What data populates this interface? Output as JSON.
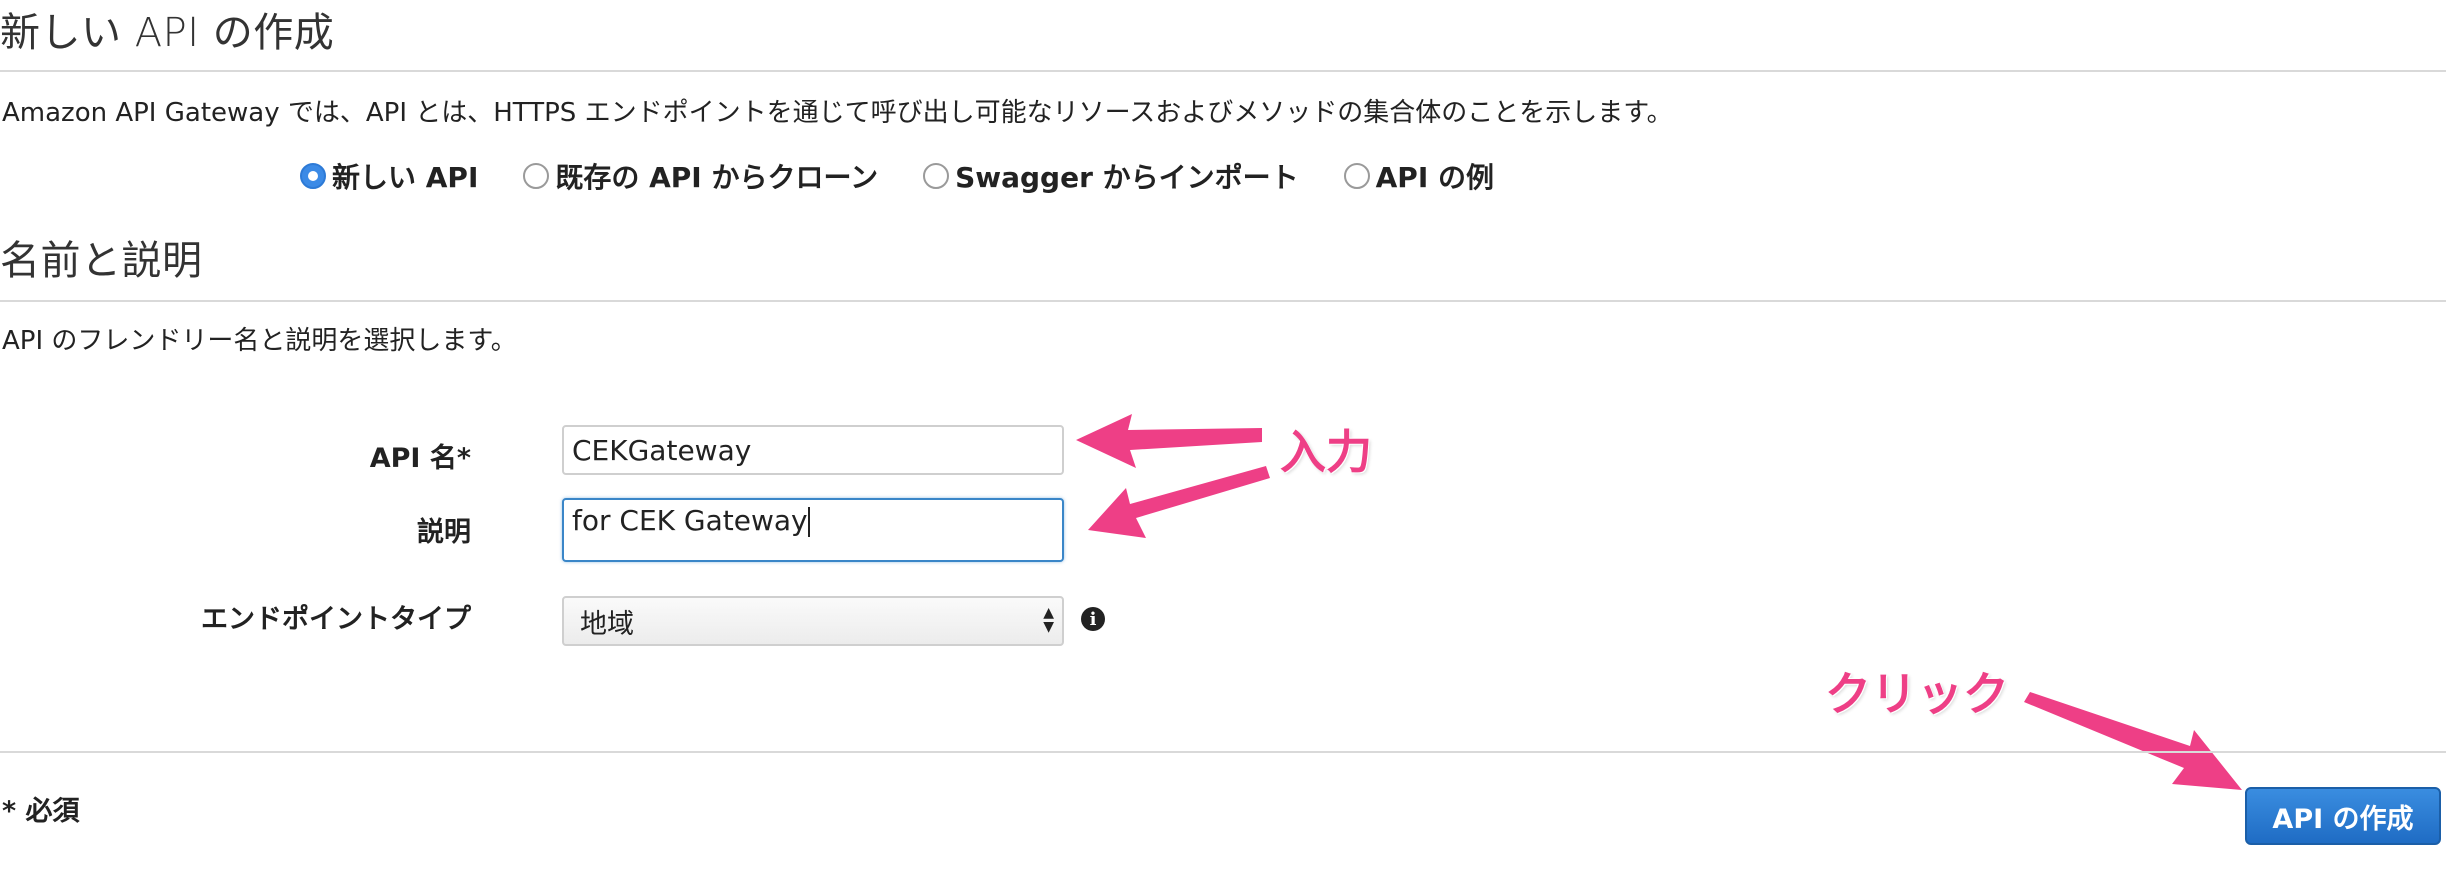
{
  "header": {
    "title": "新しい API の作成",
    "description": "Amazon API Gateway では、API とは、HTTPS エンドポイントを通じて呼び出し可能なリソースおよびメソッドの集合体のことを示します。"
  },
  "api_type": {
    "options": [
      {
        "label": "新しい API",
        "selected": true
      },
      {
        "label": "既存の API からクローン",
        "selected": false
      },
      {
        "label": "Swagger からインポート",
        "selected": false
      },
      {
        "label": "API の例",
        "selected": false
      }
    ]
  },
  "name_section": {
    "title": "名前と説明",
    "description": "API のフレンドリー名と説明を選択します。"
  },
  "form": {
    "api_name_label": "API 名*",
    "api_name_value": "CEKGateway",
    "description_label": "説明",
    "description_value": "for CEK Gateway",
    "endpoint_type_label": "エンドポイントタイプ",
    "endpoint_type_value": "地域",
    "info_icon": "info-icon"
  },
  "footer": {
    "required_note": "* 必須",
    "create_button": "API の作成"
  },
  "annotations": {
    "input_label": "入力",
    "click_label": "クリック",
    "color": "#ee3f86"
  },
  "colors": {
    "accent": "#2d7ad6",
    "button": "#1f6cc4",
    "rule": "#d9d9d9"
  }
}
